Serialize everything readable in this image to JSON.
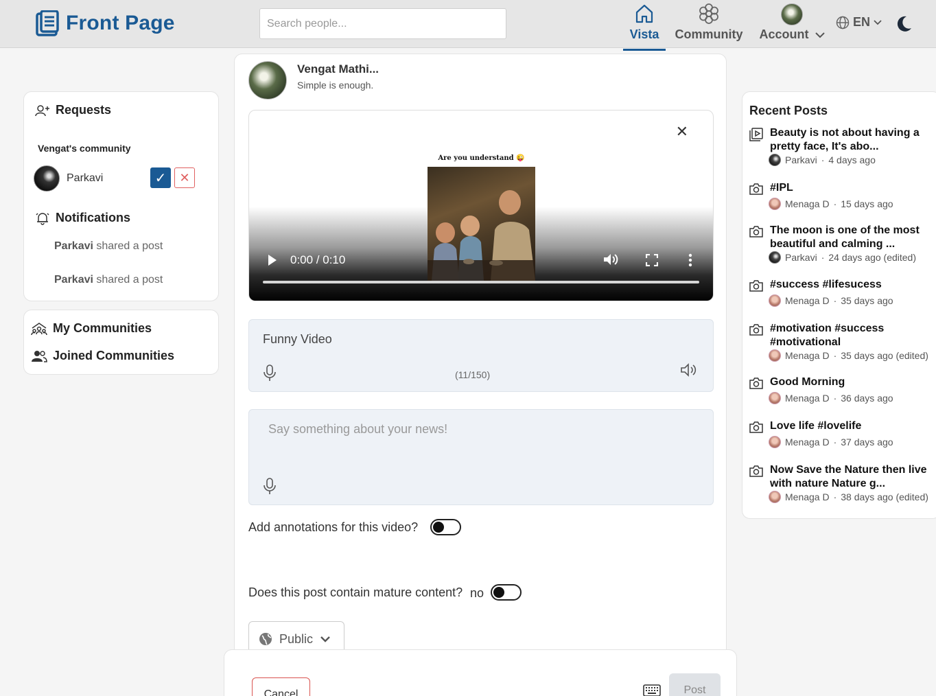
{
  "header": {
    "logo_text": "Front Page",
    "search_placeholder": "Search people...",
    "nav": {
      "vista": "Vista",
      "community": "Community",
      "account": "Account",
      "language": "EN"
    }
  },
  "left": {
    "requests_title": "Requests",
    "community_name": "Vengat's community",
    "request_user": "Parkavi",
    "accept_glyph": "✓",
    "reject_glyph": "✕",
    "notifications_title": "Notifications",
    "notifications": [
      {
        "user": "Parkavi",
        "text": " shared a post"
      },
      {
        "user": "Parkavi",
        "text": " shared a post"
      }
    ],
    "my_communities": "My Communities",
    "joined_communities": "Joined Communities"
  },
  "composer": {
    "author_name": "Vengat Mathi...",
    "author_status": "Simple is enough.",
    "video": {
      "caption": "Are you understand 😜",
      "time": "0:00 / 0:10",
      "progress": 0
    },
    "title_value": "Funny Video",
    "title_counter": "(11/150)",
    "description_placeholder": "Say something about your news!",
    "annotations_question": "Add annotations for this video?",
    "annotations_enabled": false,
    "mature_question": "Does this post contain mature content?",
    "mature_value": "no",
    "mature_enabled": false,
    "privacy": "Public",
    "cancel_label": "Cancel",
    "post_label": "Post"
  },
  "recent_posts": {
    "title": "Recent Posts",
    "items": [
      {
        "icon": "video-icon",
        "title": "Beauty is not about having a pretty face, It's abo...",
        "author": "Parkavi",
        "time": "4 days ago"
      },
      {
        "icon": "camera-icon",
        "title": "#IPL",
        "author": "Menaga D",
        "time": "15 days ago"
      },
      {
        "icon": "camera-icon",
        "title": "The moon is one of the most beautiful and calming ...",
        "author": "Parkavi",
        "time": "24 days ago (edited)"
      },
      {
        "icon": "camera-icon",
        "title": "#success #lifesucess",
        "author": "Menaga D",
        "time": "35 days ago"
      },
      {
        "icon": "camera-icon",
        "title": "#motivation #success #motivational",
        "author": "Menaga D",
        "time": "35 days ago (edited)"
      },
      {
        "icon": "camera-icon",
        "title": "Good Morning",
        "author": "Menaga D",
        "time": "36 days ago"
      },
      {
        "icon": "camera-icon",
        "title": "Love life #lovelife",
        "author": "Menaga D",
        "time": "37 days ago"
      },
      {
        "icon": "camera-icon",
        "title": "Now Save the Nature then live with nature Nature g...",
        "author": "Menaga D",
        "time": "38 days ago (edited)"
      }
    ]
  },
  "colors": {
    "brand": "#1a5a94",
    "reject": "#e06060"
  }
}
